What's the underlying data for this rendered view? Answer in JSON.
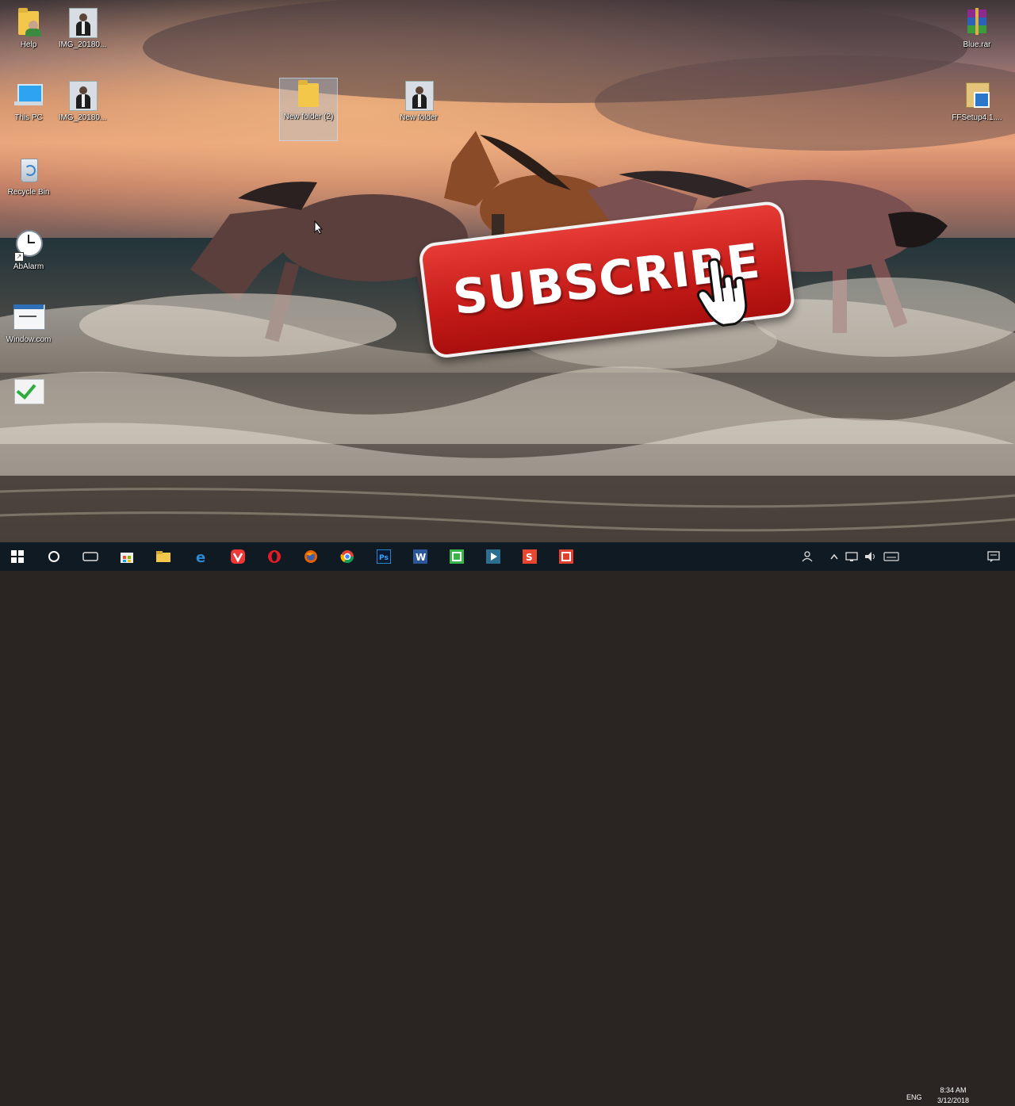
{
  "desktop": {
    "icons": [
      {
        "id": "help",
        "label": "Help",
        "glyph": "folder-person-icon"
      },
      {
        "id": "img1",
        "label": "IMG_20180...",
        "glyph": "photo-icon"
      },
      {
        "id": "thispc",
        "label": "This PC",
        "glyph": "computer-icon"
      },
      {
        "id": "img2",
        "label": "IMG_20180...",
        "glyph": "photo-icon"
      },
      {
        "id": "newfolder2",
        "label": "New folder (2)",
        "glyph": "folder-icon"
      },
      {
        "id": "newfolder",
        "label": "New folder",
        "glyph": "photo-icon"
      },
      {
        "id": "recyclebin",
        "label": "Recycle Bin",
        "glyph": "recycle-bin-icon"
      },
      {
        "id": "abalarm",
        "label": "AbAlarm",
        "glyph": "alarm-clock-icon"
      },
      {
        "id": "window",
        "label": "Window.com",
        "glyph": "window-icon"
      },
      {
        "id": "checklist",
        "label": "",
        "glyph": "checklist-icon"
      },
      {
        "id": "rar",
        "label": "Blue.rar",
        "glyph": "winrar-icon"
      },
      {
        "id": "setup",
        "label": "FFSetup4.1....",
        "glyph": "setup-icon"
      }
    ]
  },
  "overlay": {
    "subscribe_label": "SUBSCRIBE",
    "accent": "#d42a26"
  },
  "taskbar": {
    "apps": [
      "windows-start-icon",
      "cortana-icon",
      "task-view-icon",
      "store-icon",
      "file-explorer-icon",
      "edge-icon",
      "vivaldi-icon",
      "opera-icon",
      "firefox-icon",
      "chrome-icon",
      "photoshop-icon",
      "word-icon",
      "camtasia-icon",
      "media-icon",
      "wps-presentation-icon",
      "wps-writer-icon"
    ],
    "lang": "ENG",
    "time": "8:34 AM",
    "date": "3/12/2018"
  }
}
